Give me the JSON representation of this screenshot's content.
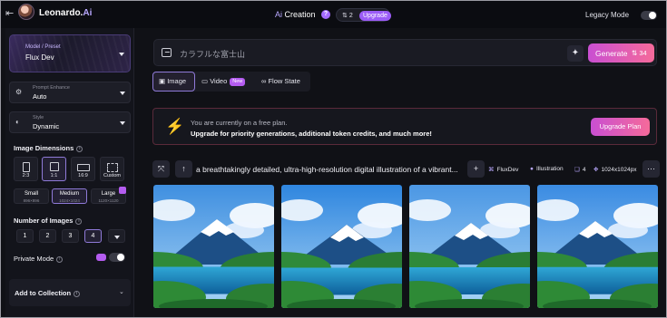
{
  "topbar": {
    "back_icon": "collapse-left-icon",
    "brand": "Leonardo.",
    "brand_ai": "Ai",
    "title_prefix": "Ai",
    "title_rest": " Creation",
    "help_icon": "question-icon",
    "token_count": "2",
    "upgrade_label": "Upgrade",
    "legacy_mode_label": "Legacy Mode",
    "legacy_mode_on": false
  },
  "sidebar": {
    "preset": {
      "label": "Model / Preset",
      "value": "Flux Dev"
    },
    "prompt_enhance": {
      "label": "Prompt Enhance",
      "value": "Auto",
      "icon": "sliders-icon"
    },
    "style": {
      "label": "Style",
      "value": "Dynamic",
      "icon": "palette-icon"
    },
    "dimensions": {
      "title": "Image Dimensions",
      "ratios": [
        "2:3",
        "1:1",
        "16:9",
        "Custom"
      ],
      "selected_ratio": "1:1",
      "sizes": [
        {
          "name": "Small",
          "px": "896×896"
        },
        {
          "name": "Medium",
          "px": "1024×1024"
        },
        {
          "name": "Large",
          "px": "1120×1120"
        }
      ],
      "selected_size": "Medium"
    },
    "number_of_images": {
      "title": "Number of Images",
      "options": [
        "1",
        "2",
        "3",
        "4"
      ],
      "selected": "4"
    },
    "private_mode": {
      "label": "Private Mode",
      "on": false
    },
    "collection": {
      "label": "Add to Collection"
    }
  },
  "prompt": {
    "placeholder": "カラフルな富士山",
    "generate_label": "Generate",
    "generate_cost": "34"
  },
  "tabs": [
    {
      "label": "Image",
      "icon": "image-icon",
      "active": true
    },
    {
      "label": "Video",
      "icon": "video-icon",
      "badge": "New"
    },
    {
      "label": "Flow State",
      "icon": "infinity-icon"
    }
  ],
  "plan_banner": {
    "line1": "You are currently on a free plan.",
    "line2": "Upgrade for priority generations, additional token credits, and much more!",
    "button": "Upgrade Plan",
    "accent": "#ff8a2a"
  },
  "generation": {
    "prompt_text": "a breathtakingly detailed, ultra-high-resolution digital illustration of a vibrant...",
    "model": "FluxDev",
    "style": "Illustration",
    "count": "4",
    "size": "1024x1024px"
  },
  "images": [
    {
      "name": "mount-fuji-lake-1"
    },
    {
      "name": "mount-fuji-lake-2"
    },
    {
      "name": "mount-fuji-lake-3"
    },
    {
      "name": "mount-fuji-lake-4"
    }
  ],
  "colors": {
    "accent": "#8f7ad8",
    "gradient_start": "#c94fd2",
    "gradient_end": "#f56a9a"
  }
}
